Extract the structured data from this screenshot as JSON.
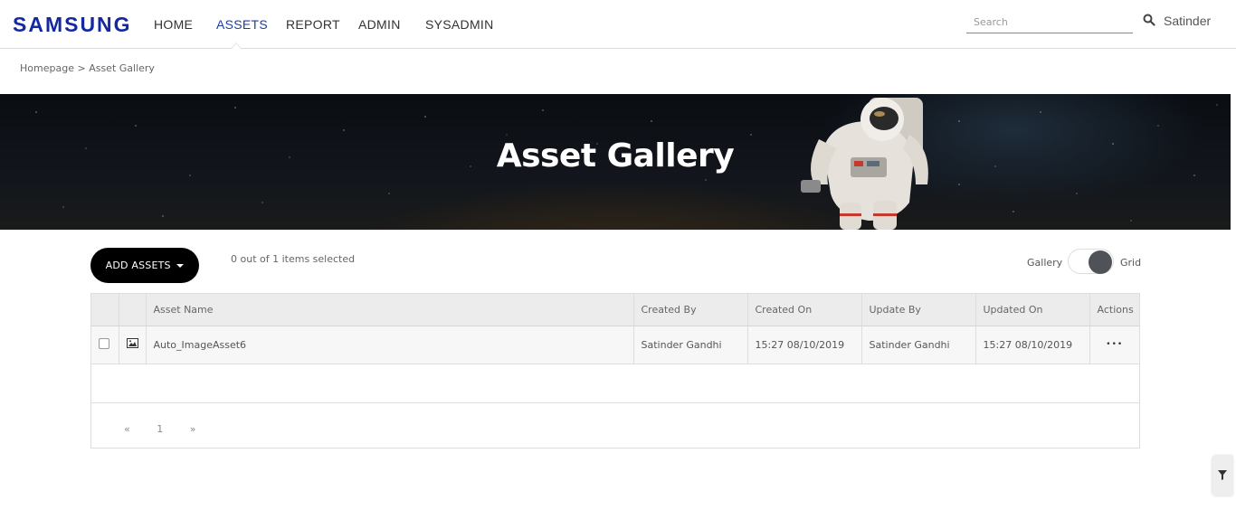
{
  "header": {
    "logo": "SAMSUNG",
    "nav": [
      {
        "label": "HOME",
        "active": false
      },
      {
        "label": "ASSETS",
        "active": true
      },
      {
        "label": "REPORT",
        "active": false
      },
      {
        "label": "ADMIN",
        "active": false
      },
      {
        "label": "SYSADMIN",
        "active": false
      }
    ],
    "search_placeholder": "Search",
    "search_icon": "search-icon",
    "username": "Satinder"
  },
  "breadcrumb": {
    "home": "Homepage",
    "separator": ">",
    "current": "Asset Gallery"
  },
  "banner": {
    "title": "Asset Gallery"
  },
  "toolbar": {
    "add_assets_label": "ADD ASSETS",
    "selection_status": "0 out of 1 items selected",
    "view_toggle": {
      "left_label": "Gallery",
      "right_label": "Grid",
      "selected": "Grid"
    }
  },
  "table": {
    "columns": [
      "",
      "",
      "Asset Name",
      "Created By",
      "Created On",
      "Update By",
      "Updated On",
      "Actions"
    ],
    "rows": [
      {
        "checked": false,
        "type_icon": "image-icon",
        "asset_name": "Auto_ImageAsset6",
        "created_by": "Satinder Gandhi",
        "created_on": "15:27 08/10/2019",
        "update_by": "Satinder Gandhi",
        "updated_on": "15:27 08/10/2019",
        "actions": "•••"
      }
    ]
  },
  "pagination": {
    "prev": "«",
    "current_page": "1",
    "next": "»"
  },
  "filter_tab_icon": "filter-icon",
  "colors": {
    "brand": "#1428a0",
    "active_nav": "#1c3ea0",
    "button_bg": "#000000",
    "toggle_knob": "#4f5257"
  }
}
